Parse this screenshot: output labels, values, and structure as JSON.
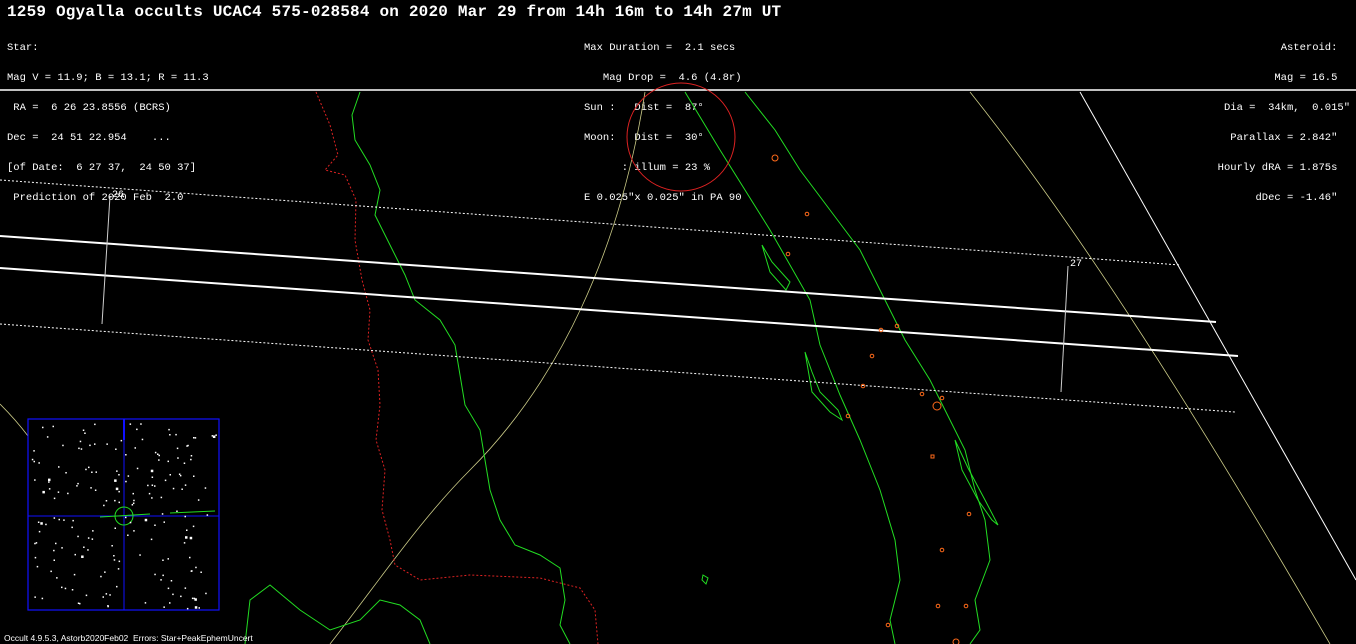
{
  "header": {
    "title": "1259 Ogyalla occults UCAC4 575-028584 on 2020 Mar 29 from 14h 16m to 14h 27m UT"
  },
  "star_block": [
    "Star:",
    "Mag V = 11.9; B = 13.1; R = 11.3",
    " RA =  6 26 23.8556 (BCRS)",
    "Dec =  24 51 22.954    ...",
    "[of Date:  6 27 37,  24 50 37]",
    " Prediction of 2020 Feb  2.0"
  ],
  "event_block": [
    "Max Duration =  2.1 secs",
    "   Mag Drop =  4.6 (4.8r)",
    "Sun :   Dist =  87°",
    "Moon:   Dist =  30°",
    "      : illum = 23 %",
    "E 0.025\"x 0.025\" in PA 90"
  ],
  "asteroid_block": [
    "Asteroid:  ",
    "Mag = 16.5  ",
    "Dia =  34km,  0.015\"",
    "Parallax = 2.842\"  ",
    "Hourly dRA = 1.875s  ",
    "dDec = -1.46\"  "
  ],
  "time_marks": {
    "start": "26",
    "end": "27"
  },
  "footer": "Occult 4.9.5.3, Astorb2020Feb02  Errors: Star+PeakEphemUncert",
  "colors": {
    "background": "#000000",
    "text": "#ffffff",
    "path_lines": "#ffffff",
    "coastline": "#22dd22",
    "border": "#dd2222",
    "sunlit_limit": "#cccc88",
    "city_marker": "#ff6a1a",
    "star_chart_frame": "#1010ff"
  },
  "icons": {
    "moon_marker": "red-circle",
    "chart_target": "green-circle"
  }
}
